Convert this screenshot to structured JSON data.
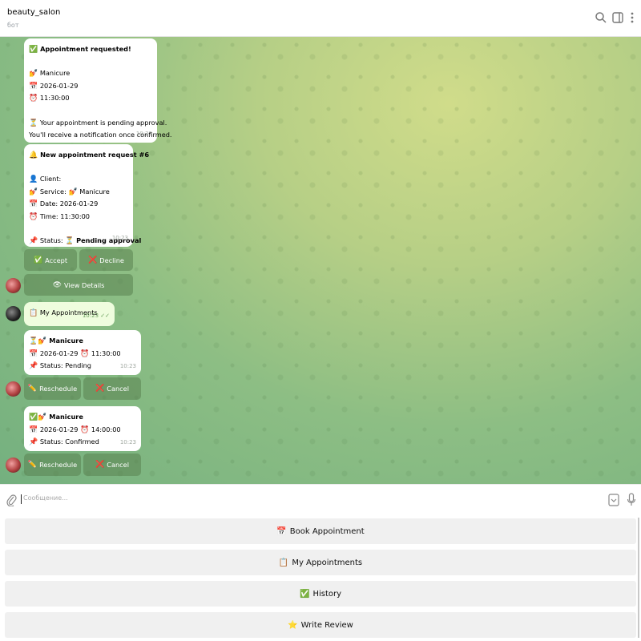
{
  "header": {
    "title": "beauty_salon",
    "subtitle": "бот",
    "icons": [
      "search-icon",
      "sidebar-toggle-icon",
      "more-vert-icon"
    ]
  },
  "messages": {
    "m1": {
      "l1": "Appointment requested!",
      "l2": "Manicure",
      "l3": "2026-01-29",
      "l4": "11:30:00",
      "l5": "Your appointment is pending approval.",
      "l6": "You'll receive a notification once confirmed.",
      "time": "10:23"
    },
    "m2": {
      "l1": "New appointment request #6",
      "l2": "Client:",
      "l3a": "Service:",
      "l3b": "Manicure",
      "l4": "Date: 2026-01-29",
      "l5": "Time: 11:30:00",
      "l6a": "Status:",
      "l6b": "Pending approval",
      "time": "10:23",
      "btn_accept": "Accept",
      "btn_decline": "Decline",
      "btn_details": "View Details"
    },
    "m3": {
      "text": "My Appointments",
      "time": "10:23",
      "ticks": "✓✓"
    },
    "m4": {
      "l1": "Manicure",
      "l2a": "2026-01-29",
      "l2b": "11:30:00",
      "l3": "Status: Pending",
      "time": "10:23",
      "btn_reschedule": "Reschedule",
      "btn_cancel": "Cancel"
    },
    "m5": {
      "l1": "Manicure",
      "l2a": "2026-01-29",
      "l2b": "14:00:00",
      "l3": "Status: Confirmed",
      "time": "10:23",
      "btn_reschedule": "Reschedule",
      "btn_cancel": "Cancel"
    }
  },
  "emoji": {
    "check": "✅",
    "nail": "💅",
    "calendar": "📅",
    "clock": "⏰",
    "hourglass": "⏳",
    "bell": "🔔",
    "person": "👤",
    "pin": "📌",
    "accept": "✅",
    "cross": "❌",
    "eye": "👁",
    "clipboard": "📋",
    "pencil": "✏️",
    "star": "⭐"
  },
  "input": {
    "placeholder": "Сообщение..."
  },
  "reply_keyboard": {
    "book": "Book Appointment",
    "my": "My Appointments",
    "history": "History",
    "review": "Write Review"
  },
  "colors": {
    "accent_outgoing": "#effdde",
    "keyboard_button": "#f0f0f0"
  }
}
